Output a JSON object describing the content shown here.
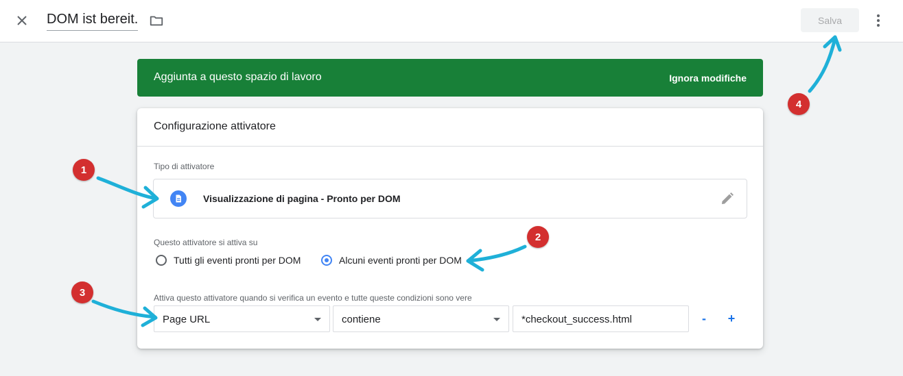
{
  "header": {
    "title": "DOM ist bereit.",
    "save_label": "Salva"
  },
  "banner": {
    "text": "Aggiunta a questo spazio di lavoro",
    "action_label": "Ignora modifiche",
    "color": "#188038"
  },
  "card": {
    "title": "Configurazione attivatore",
    "trigger_type_label": "Tipo di attivatore",
    "trigger_type_name": "Visualizzazione di pagina - Pronto per DOM",
    "fires_on_label": "Questo attivatore si attiva su",
    "radio_all_label": "Tutti gli eventi pronti per DOM",
    "radio_some_label": "Alcuni eventi pronti per DOM",
    "selected_option": "Alcuni eventi pronti per DOM",
    "condition_label": "Attiva questo attivatore quando si verifica un evento e tutte queste condizioni sono vere",
    "condition": {
      "variable": "Page URL",
      "operator": "contiene",
      "value": "*checkout_success.html"
    },
    "remove_label": "-",
    "add_label": "+"
  },
  "annotations": {
    "badges": [
      "1",
      "2",
      "3",
      "4"
    ],
    "badge_color": "#d32f2f",
    "arrow_color": "#1fb0d8"
  },
  "icons": [
    "close-icon",
    "folder-icon",
    "more-vert-icon",
    "document-icon",
    "pencil-icon",
    "dropdown-caret-icon"
  ]
}
